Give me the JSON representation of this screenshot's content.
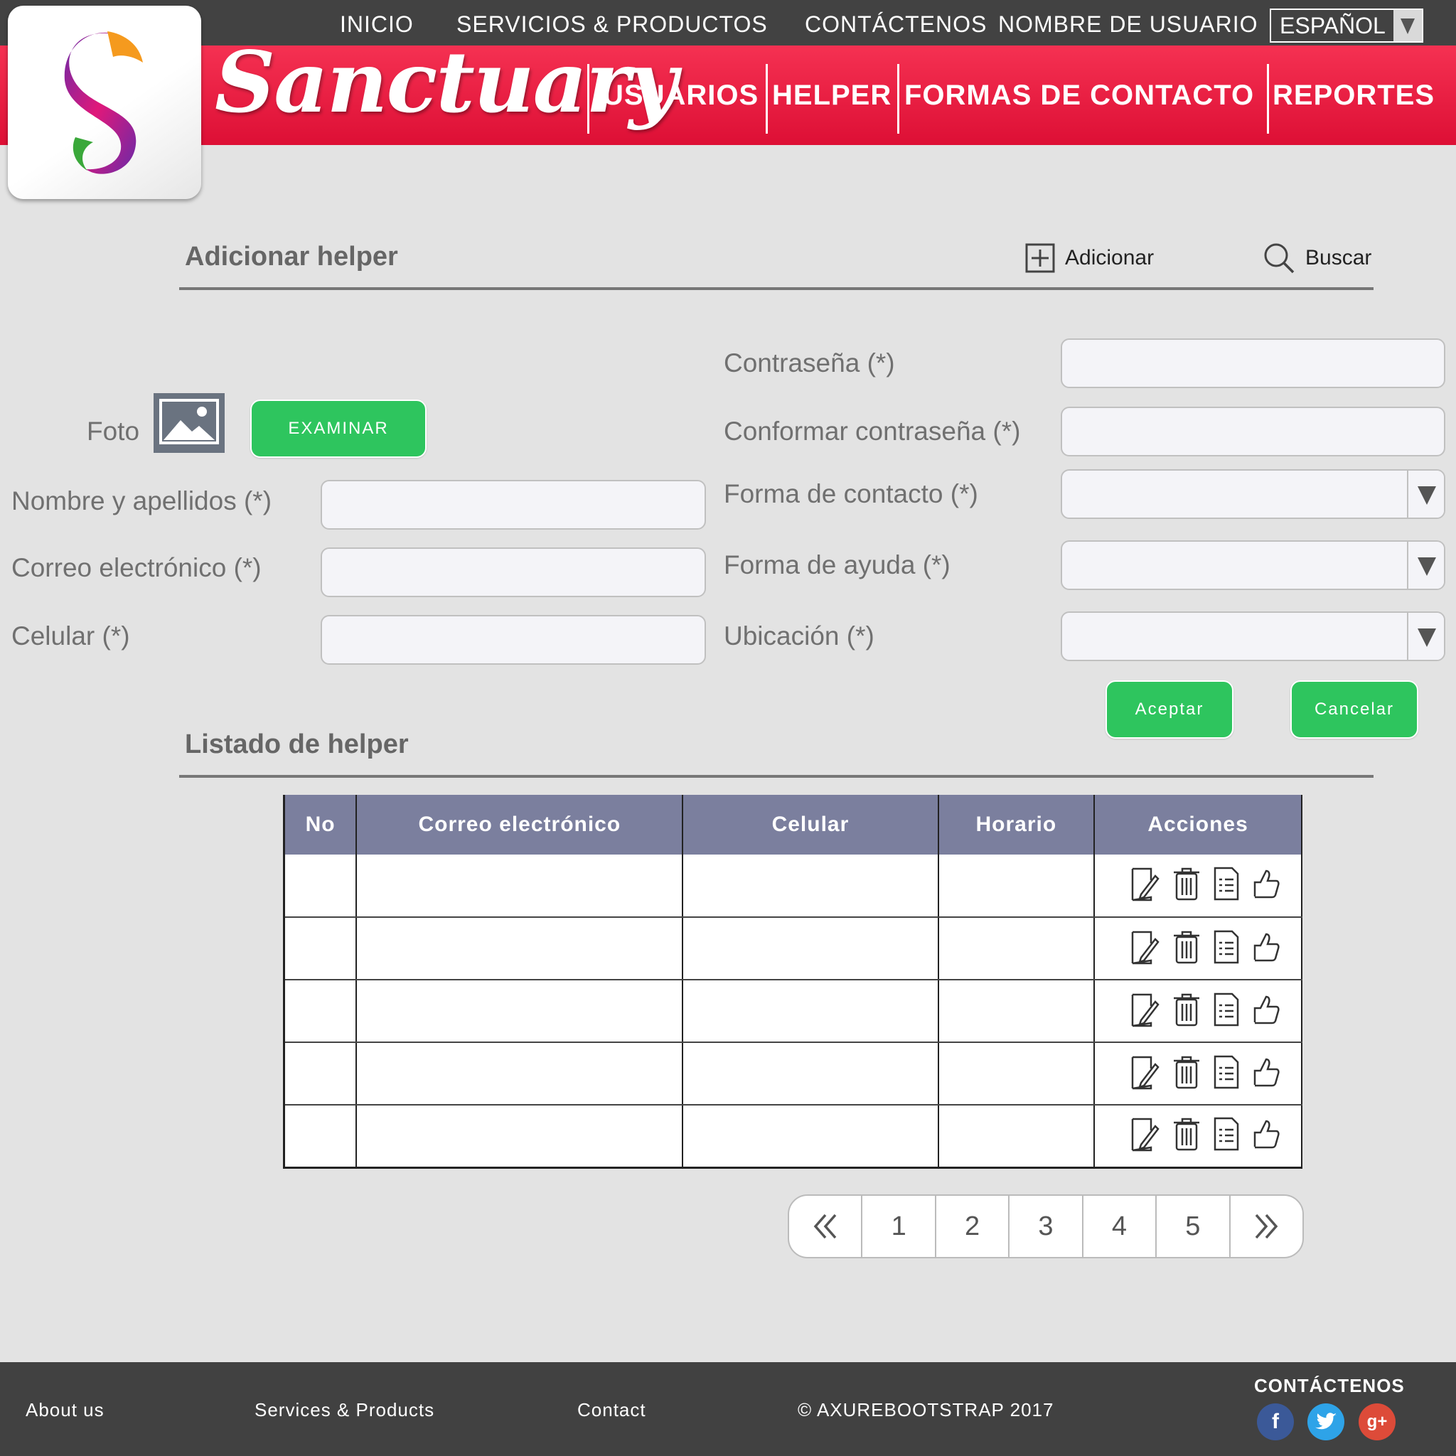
{
  "header": {
    "top_nav": [
      "INICIO",
      "SERVICIOS & PRODUCTOS",
      "CONTÁCTENOS",
      "NOMBRE DE USUARIO"
    ],
    "language": "ESPAÑOL",
    "brand": "Sanctuary",
    "main_nav": [
      "USUARIOS",
      "HELPER",
      "FORMAS DE CONTACTO",
      "REPORTES"
    ]
  },
  "form_section": {
    "title": "Adicionar helper",
    "add_label": "Adicionar",
    "search_label": "Buscar"
  },
  "form": {
    "photo_label": "Foto",
    "browse_button": "EXAMINAR",
    "left_fields": [
      {
        "label": "Nombre y apellidos (*)",
        "value": ""
      },
      {
        "label": "Correo electrónico (*)",
        "value": ""
      },
      {
        "label": "Celular (*)",
        "value": ""
      }
    ],
    "right_fields": [
      {
        "label": "Contraseña (*)",
        "value": ""
      },
      {
        "label": "Conformar contraseña (*)",
        "value": ""
      }
    ],
    "right_selects": [
      {
        "label": "Forma de contacto (*)",
        "value": ""
      },
      {
        "label": "Forma de ayuda (*)",
        "value": ""
      },
      {
        "label": "Ubicación (*)",
        "value": ""
      }
    ],
    "accept_button": "Aceptar",
    "cancel_button": "Cancelar"
  },
  "list_section": {
    "title": "Listado de helper"
  },
  "table": {
    "columns": [
      "No",
      "Correo electrónico",
      "Celular",
      "Horario",
      "Acciones"
    ],
    "rows": [
      {
        "no": "",
        "email": "",
        "phone": "",
        "schedule": ""
      },
      {
        "no": "",
        "email": "",
        "phone": "",
        "schedule": ""
      },
      {
        "no": "",
        "email": "",
        "phone": "",
        "schedule": ""
      },
      {
        "no": "",
        "email": "",
        "phone": "",
        "schedule": ""
      },
      {
        "no": "",
        "email": "",
        "phone": "",
        "schedule": ""
      }
    ],
    "row_action_icons": [
      "edit-icon",
      "delete-icon",
      "details-icon",
      "like-icon"
    ]
  },
  "pagination": {
    "first_icon": "double-chevron-left-icon",
    "pages": [
      "1",
      "2",
      "3",
      "4",
      "5"
    ],
    "last_icon": "double-chevron-right-icon"
  },
  "footer": {
    "links": [
      "About us",
      "Services & Products",
      "Contact"
    ],
    "copyright": "© AXUREBOOTSTRAP 2017",
    "contact_title": "CONTÁCTENOS",
    "social_icons": [
      "facebook-icon",
      "twitter-icon",
      "google-plus-icon"
    ]
  },
  "colors": {
    "header_dark": "#424242",
    "header_red": "#e41c3e",
    "accent_green": "#2ec55e",
    "table_header": "#7b7f9e",
    "footer": "#414141"
  }
}
